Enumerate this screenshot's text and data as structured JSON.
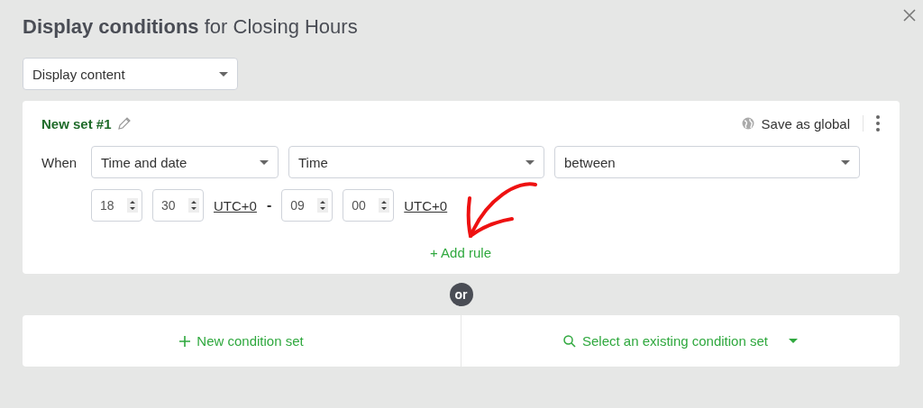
{
  "dialog": {
    "title": "**Display conditions** for Closing Hours"
  },
  "action_select": {
    "value": "Display content"
  },
  "condition_set": {
    "name": "New set #1",
    "save_global": "Save as global",
    "rule": {
      "label": "When",
      "selects": [
        "Time and date",
        "Time",
        "between"
      ],
      "start": {
        "hour": "18",
        "minute": "30",
        "timezone": "UTC+0"
      },
      "separator": "-",
      "end": {
        "hour": "09",
        "minute": "00",
        "timezone": "UTC+0"
      }
    },
    "add_rule": "+ Add rule"
  },
  "divider_label": "or",
  "footer": {
    "new_set": "New condition set",
    "select_existing": "Select an existing condition set"
  }
}
